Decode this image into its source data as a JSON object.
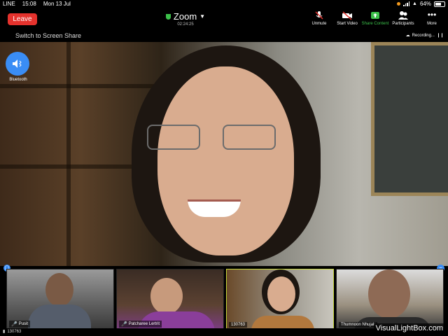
{
  "status_bar": {
    "carrier": "LINE",
    "time": "15:08",
    "date": "Mon 13 Jul",
    "battery": "64%"
  },
  "toolbar": {
    "leave_label": "Leave",
    "app_title": "Zoom",
    "timer": "02:24:25",
    "unmute_label": "Unmute",
    "start_video_label": "Start Video",
    "share_content_label": "Share Content",
    "participants_label": "Participants",
    "more_label": "More"
  },
  "share_bar": {
    "label": "Switch to Screen Share",
    "recording_label": "Recording..."
  },
  "audio": {
    "bluetooth_label": "Bluetooth"
  },
  "thumbnails": [
    {
      "name": "Pusit",
      "muted": true
    },
    {
      "name": "Patcharee Lertrit",
      "muted": true
    },
    {
      "name": "130763",
      "muted": false
    },
    {
      "name": "Thumnoon Nhujak",
      "muted": false
    }
  ],
  "footer": {
    "participant_count": "130763",
    "watermark": "VisualLightBox.com"
  },
  "colors": {
    "leave": "#e5322d",
    "share_green": "#3cc04a",
    "accent_blue": "#3a8df5",
    "active_border": "#c7d83a"
  }
}
